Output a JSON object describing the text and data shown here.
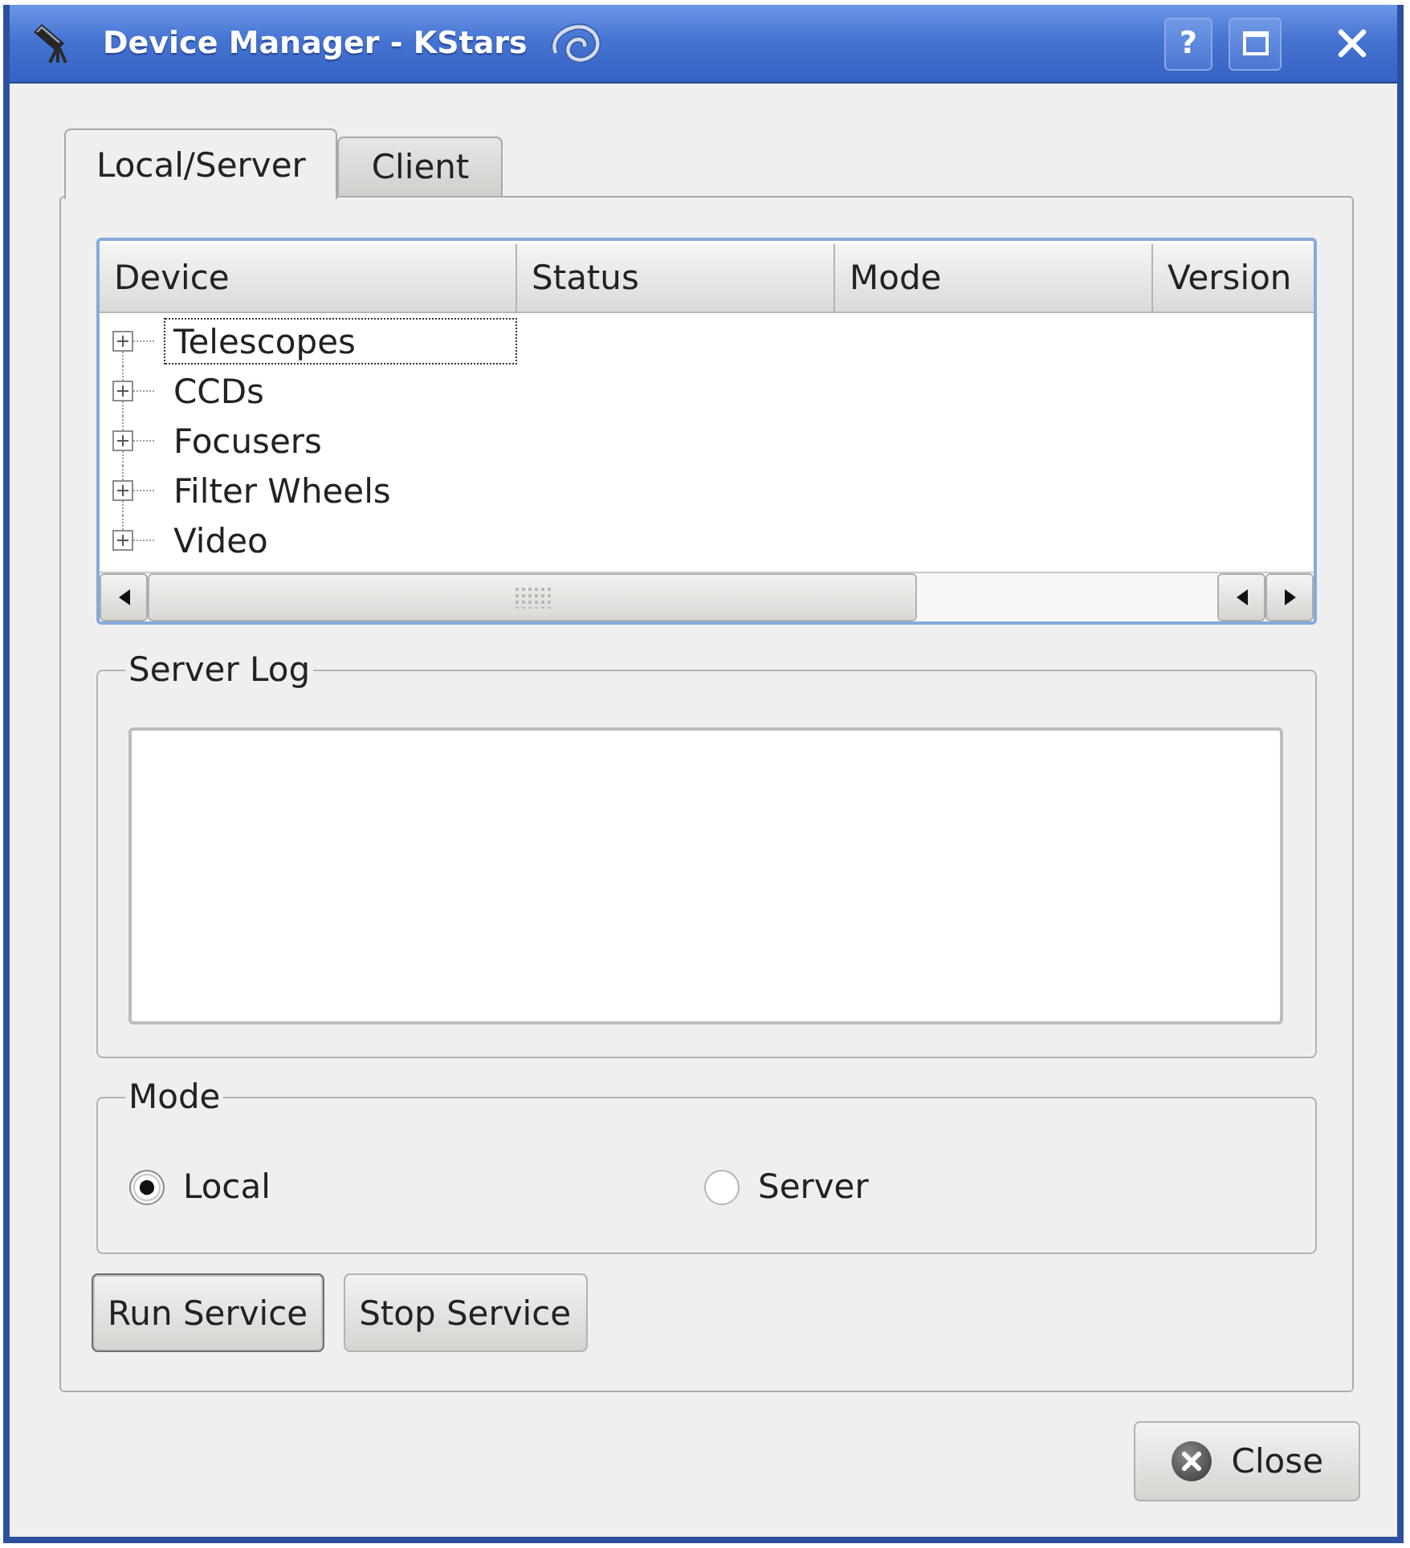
{
  "window": {
    "title": "Device Manager - KStars",
    "help_button": "?"
  },
  "tabs": [
    {
      "label": "Local/Server",
      "selected": true
    },
    {
      "label": "Client",
      "selected": false
    }
  ],
  "device_tree": {
    "columns": [
      "Device",
      "Status",
      "Mode",
      "Version"
    ],
    "items": [
      {
        "label": "Telescopes",
        "expanded": false,
        "selected": true
      },
      {
        "label": "CCDs",
        "expanded": false,
        "selected": false
      },
      {
        "label": "Focusers",
        "expanded": false,
        "selected": false
      },
      {
        "label": "Filter Wheels",
        "expanded": false,
        "selected": false
      },
      {
        "label": "Video",
        "expanded": false,
        "selected": false
      }
    ]
  },
  "server_log": {
    "title": "Server Log"
  },
  "mode": {
    "title": "Mode",
    "options": [
      {
        "label": "Local",
        "selected": true
      },
      {
        "label": "Server",
        "selected": false
      }
    ]
  },
  "service_buttons": [
    {
      "label": "Run Service",
      "default": true
    },
    {
      "label": "Stop Service",
      "default": false
    }
  ],
  "close_button": {
    "label": "Close"
  }
}
